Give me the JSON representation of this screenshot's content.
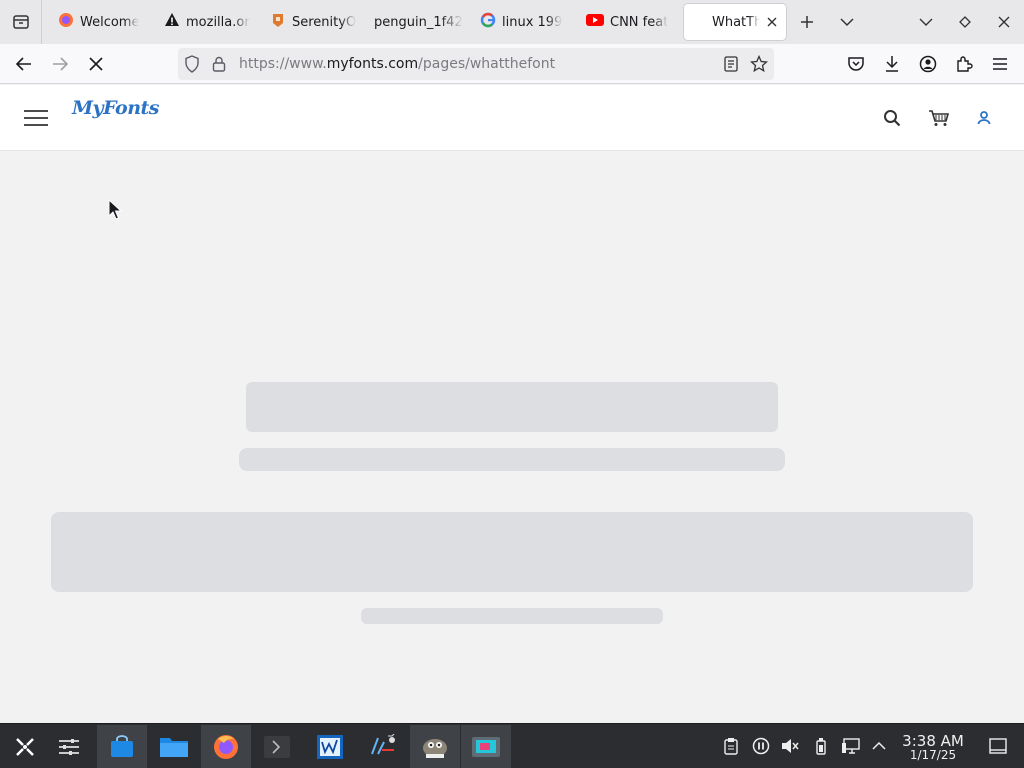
{
  "browser": {
    "tabs": [
      {
        "title": "Welcome",
        "icon": "firefox-icon"
      },
      {
        "title": "mozilla.or",
        "icon": "warning-icon"
      },
      {
        "title": "SerenityO",
        "icon": "serenity-icon"
      },
      {
        "title": "penguin_1f42",
        "icon": "none"
      },
      {
        "title": "linux 199",
        "icon": "google-icon"
      },
      {
        "title": "CNN feat",
        "icon": "youtube-icon"
      },
      {
        "title": "WhatTh",
        "icon": "none",
        "active": true
      }
    ],
    "url": {
      "prefix": "https://www.",
      "domain": "myfonts.com",
      "path": "/pages/whatthefont"
    },
    "status": "loading"
  },
  "site": {
    "logo_text": "MyFonts"
  },
  "taskbar": {
    "apps": [
      "launcher-icon",
      "settings-icon",
      "store-icon",
      "files-icon",
      "firefox-icon",
      "terminal-icon",
      "monitor-icon",
      "audio-icon",
      "gimp-icon",
      "presentation-icon"
    ],
    "clock": {
      "time": "3:38 AM",
      "date": "1/17/25"
    }
  },
  "colors": {
    "accent": "#2c73c6",
    "skeleton": "#dcdee1",
    "taskbar": "#2b2d31"
  }
}
